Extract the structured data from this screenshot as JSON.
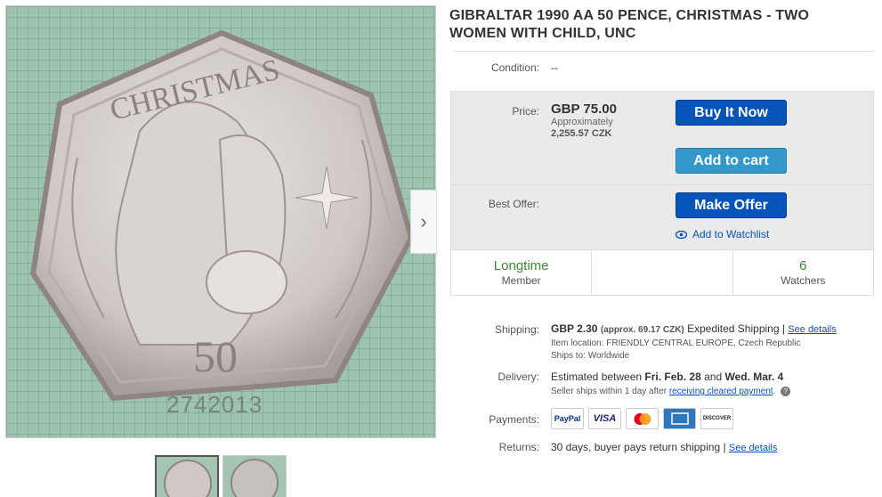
{
  "title": "GIBRALTAR 1990 AA 50 PENCE, CHRISTMAS - TWO WOMEN WITH CHILD, UNC",
  "coin": {
    "header_text": "CHRISTMAS",
    "denomination": "50",
    "watermark": "2742013"
  },
  "condition": {
    "label": "Condition:",
    "value": "--"
  },
  "price": {
    "label": "Price:",
    "value": "GBP 75.00",
    "approx_label": "Approximately",
    "approx_value": "2,255.57 CZK"
  },
  "buttons": {
    "buy_now": "Buy It Now",
    "add_to_cart": "Add to cart",
    "make_offer": "Make Offer",
    "watchlist": "Add to Watchlist"
  },
  "best_offer": {
    "label": "Best Offer:"
  },
  "stats": [
    {
      "big": "Longtime",
      "small": "Member"
    },
    {
      "big": "",
      "small": ""
    },
    {
      "big": "6",
      "small": "Watchers"
    }
  ],
  "shipping": {
    "label": "Shipping:",
    "price": "GBP 2.30",
    "approx": "(approx. 69.17 CZK)",
    "service": "Expedited Shipping |",
    "details_link": "See details",
    "item_location": "Item location:  FRIENDLY CENTRAL EUROPE, Czech Republic",
    "ships_to": "Ships to:  Worldwide"
  },
  "delivery": {
    "label": "Delivery:",
    "prefix": "Estimated between ",
    "date_from": "Fri. Feb. 28",
    "and": " and ",
    "date_to": "Wed. Mar. 4",
    "handling": "Seller ships within 1 day after",
    "handling_link": "receiving cleared payment",
    "handling_end": "."
  },
  "payments": {
    "label": "Payments:",
    "methods": [
      "PayPal",
      "VISA",
      "MasterCard",
      "AMEX",
      "DISCOVER"
    ]
  },
  "returns": {
    "label": "Returns:",
    "value": "30 days, buyer pays return shipping |",
    "details_link": "See details"
  },
  "colors": {
    "accent": "#0654ba",
    "cart": "#3498ca",
    "green": "#3a8b35"
  }
}
